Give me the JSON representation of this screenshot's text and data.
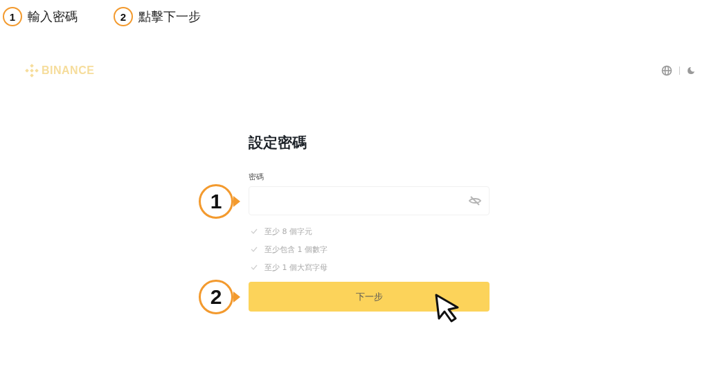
{
  "legend": [
    {
      "number": "1",
      "label": "輸入密碼"
    },
    {
      "number": "2",
      "label": "點擊下一步"
    }
  ],
  "header": {
    "logo": "BINANCE"
  },
  "form": {
    "title": "設定密碼",
    "field_label": "密碼",
    "password": {
      "callout": "1"
    },
    "rules": [
      {
        "text": "至少 8 個字元",
        "met": false
      },
      {
        "text": "至少包含 1 個數字",
        "met": false
      },
      {
        "text": "至少 1 個大寫字母",
        "met": false
      }
    ],
    "submit": {
      "label": "下一步",
      "callout": "2"
    }
  }
}
